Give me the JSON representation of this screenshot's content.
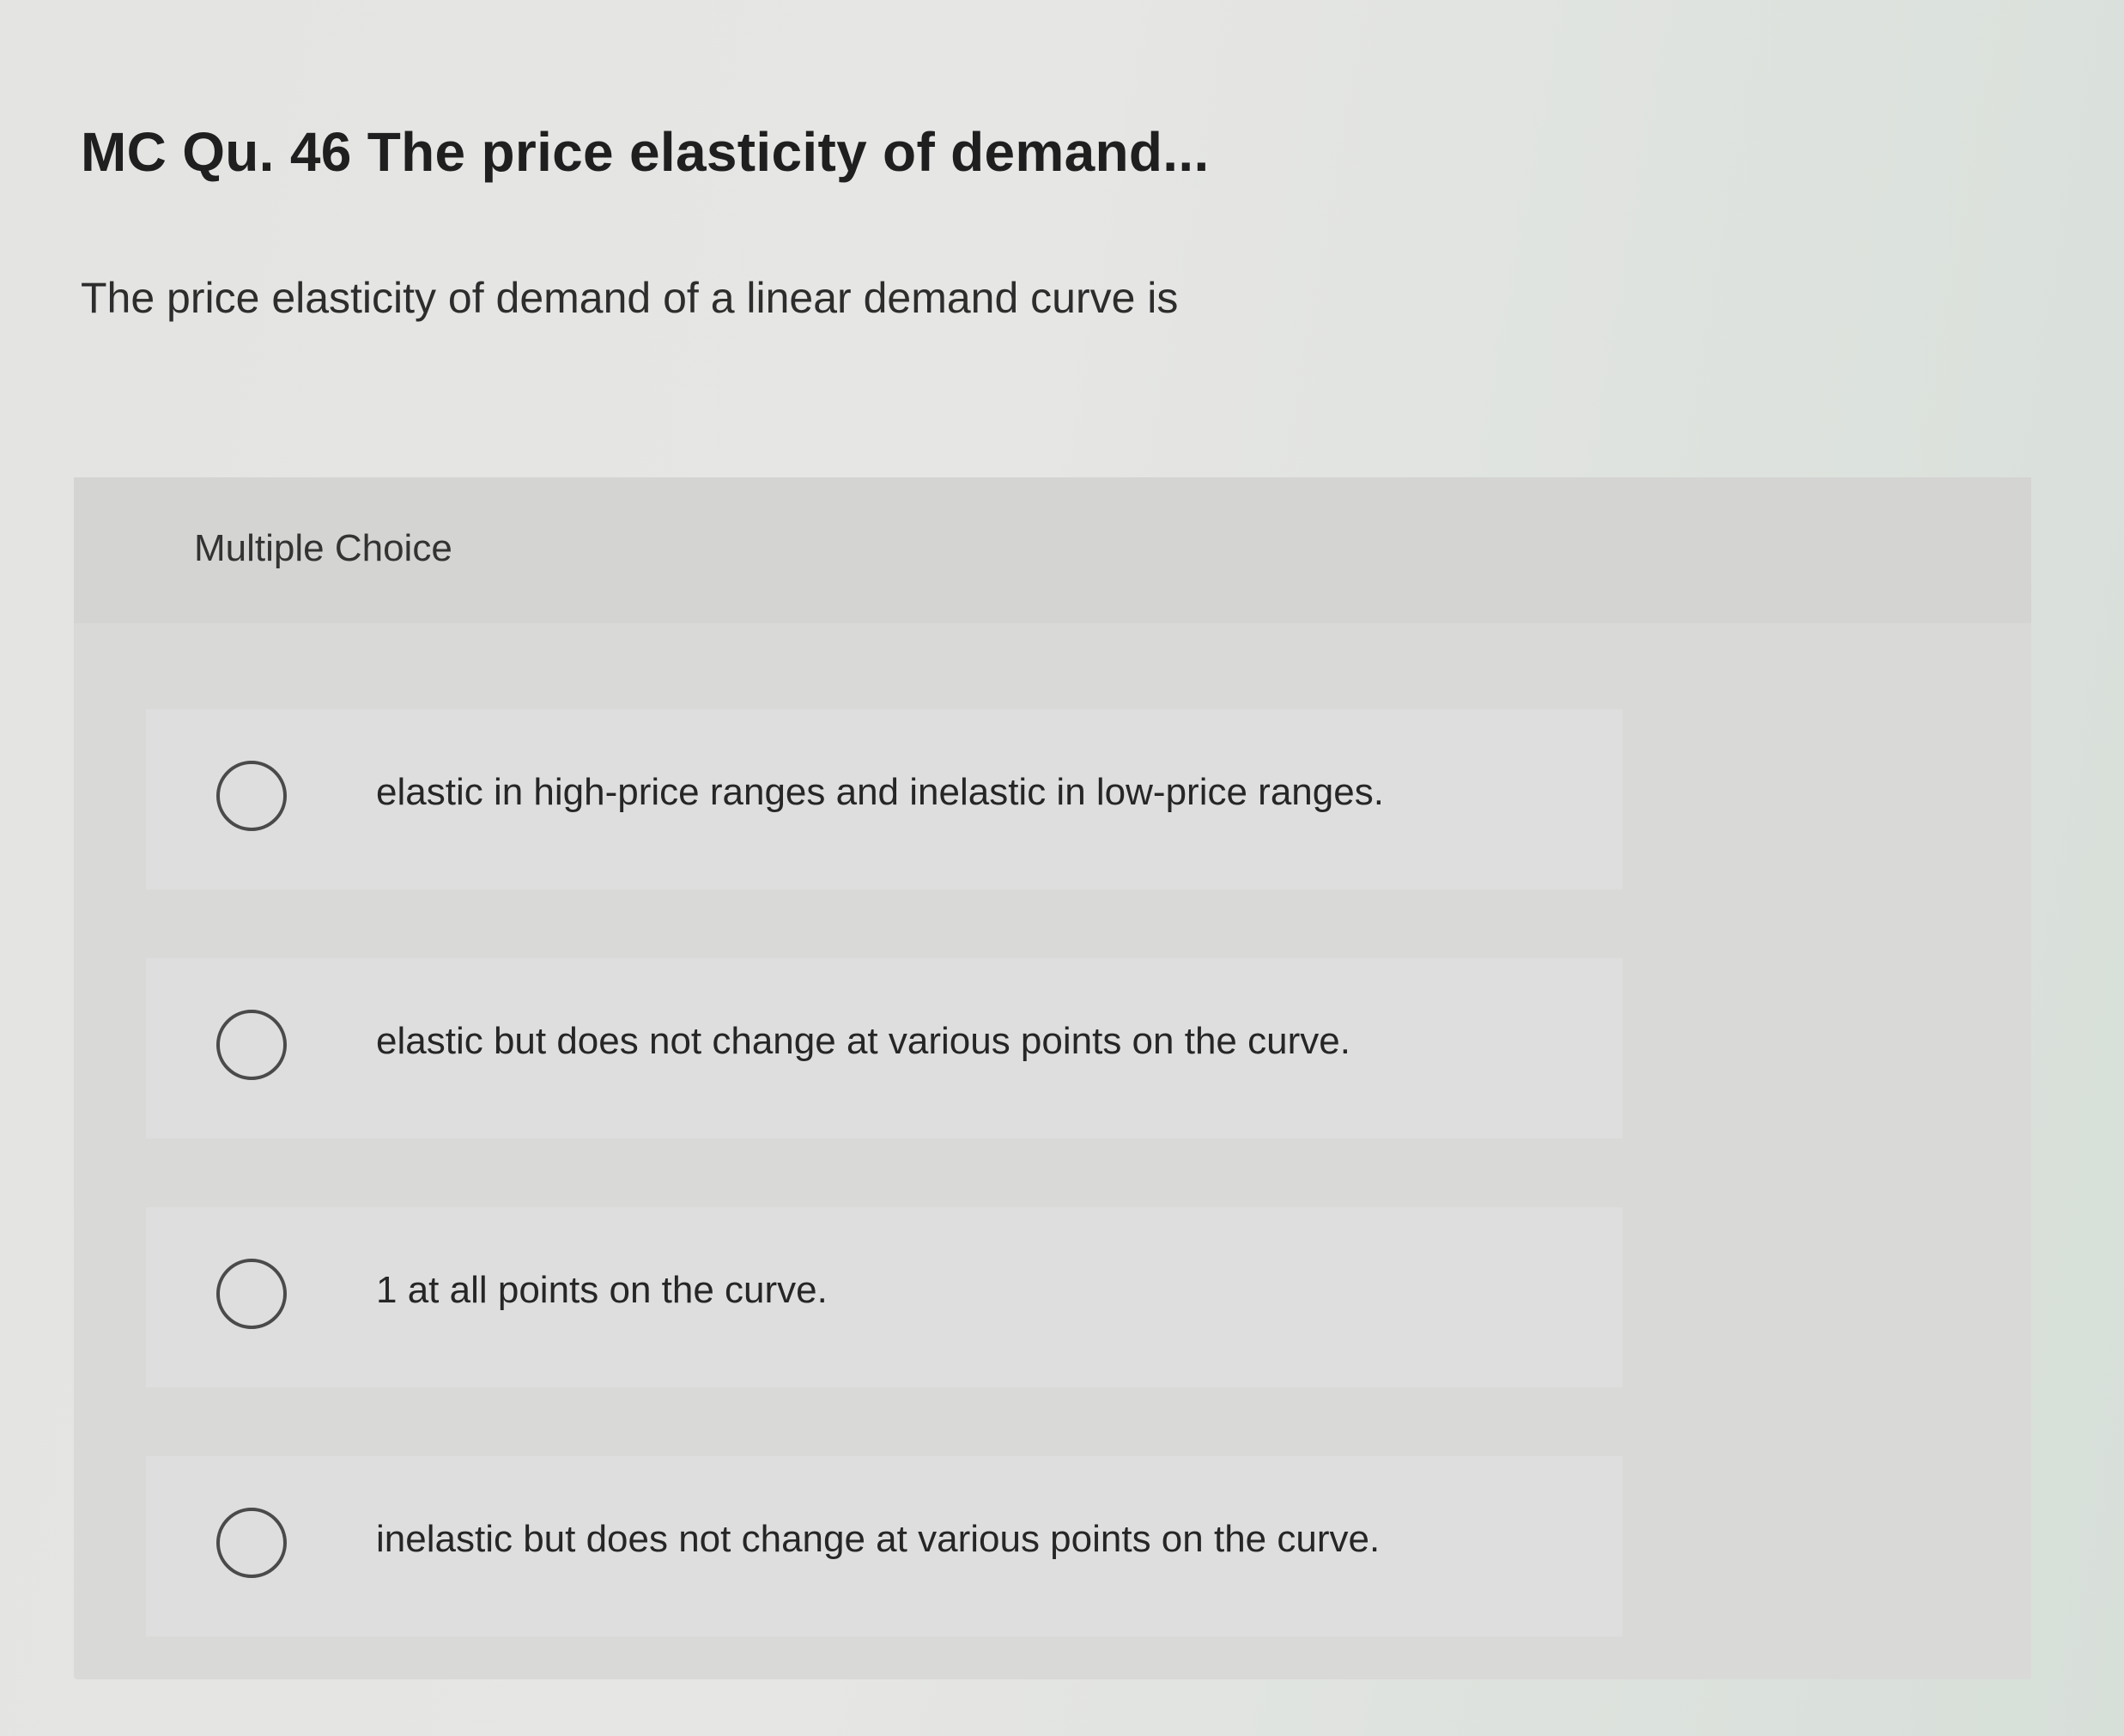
{
  "question": {
    "title": "MC Qu. 46 The price elasticity of demand...",
    "prompt": "The price elasticity of demand of a linear demand curve is"
  },
  "choices": {
    "type_label": "Multiple Choice",
    "options": [
      {
        "text": "elastic in high-price ranges and inelastic in low-price ranges."
      },
      {
        "text": "elastic but does not change at various points on the curve."
      },
      {
        "text": "1 at all points on the curve."
      },
      {
        "text": "inelastic but does not change at various points on the curve."
      }
    ],
    "radio_icon": "empty-radio-circle"
  }
}
